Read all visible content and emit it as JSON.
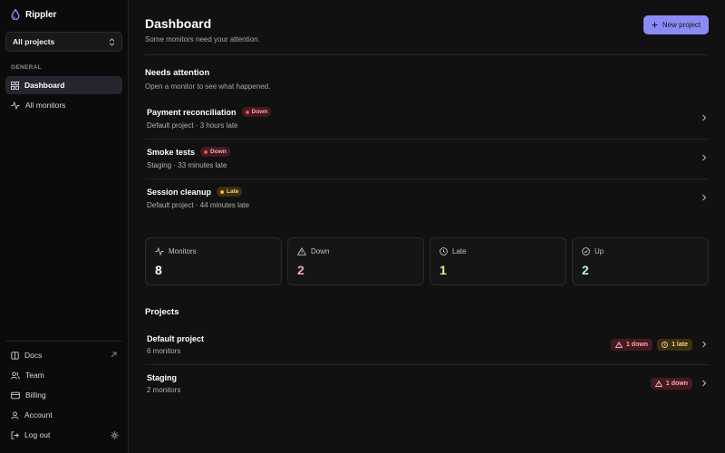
{
  "app": {
    "name": "Rippler"
  },
  "sidebar": {
    "project_select": {
      "value": "All projects"
    },
    "section_label": "GENERAL",
    "nav": [
      {
        "label": "Dashboard",
        "icon": "dashboard-icon",
        "active": true
      },
      {
        "label": "All monitors",
        "icon": "activity-icon",
        "active": false
      }
    ],
    "footer": [
      {
        "label": "Docs",
        "icon": "book-icon"
      },
      {
        "label": "Team",
        "icon": "users-icon"
      },
      {
        "label": "Billing",
        "icon": "card-icon"
      },
      {
        "label": "Account",
        "icon": "user-icon"
      },
      {
        "label": "Log out",
        "icon": "logout-icon"
      }
    ]
  },
  "header": {
    "title": "Dashboard",
    "subtitle": "Some monitors need your attention.",
    "new_project_label": "New project"
  },
  "attention": {
    "title": "Needs attention",
    "subtitle": "Open a monitor to see what happened.",
    "items": [
      {
        "name": "Payment reconciliation",
        "status": "Down",
        "meta": "Default project · 3 hours late"
      },
      {
        "name": "Smoke tests",
        "status": "Down",
        "meta": "Staging · 33 minutes late"
      },
      {
        "name": "Session cleanup",
        "status": "Late",
        "meta": "Default project · 44 minutes late"
      }
    ]
  },
  "stats": [
    {
      "label": "Monitors",
      "value": "8",
      "icon": "activity-icon",
      "color": "#ffffff"
    },
    {
      "label": "Down",
      "value": "2",
      "icon": "warning-icon",
      "color": "#f5a7b0"
    },
    {
      "label": "Late",
      "value": "1",
      "icon": "clock-icon",
      "color": "#f6e08a"
    },
    {
      "label": "Up",
      "value": "2",
      "icon": "check-circle-icon",
      "color": "#b9f2c2"
    }
  ],
  "projects": {
    "title": "Projects",
    "items": [
      {
        "name": "Default project",
        "meta": "6 monitors",
        "down": "1 down",
        "late": "1 late"
      },
      {
        "name": "Staging",
        "meta": "2 monitors",
        "down": "1 down"
      }
    ]
  },
  "colors": {
    "accent": "#8b8bf8",
    "down": "#ef4e5e",
    "late": "#f1b93a"
  }
}
